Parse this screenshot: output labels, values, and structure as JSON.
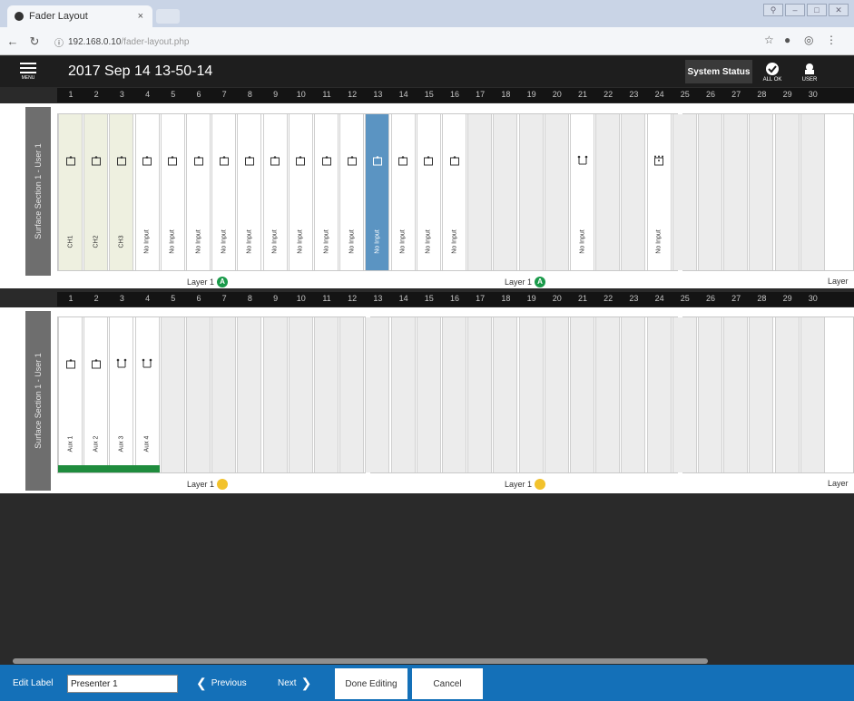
{
  "browser": {
    "tab_title": "Fader Layout",
    "tab_close": "×",
    "url_host": "192.168.0.10",
    "url_path": "/fader-layout.php"
  },
  "header": {
    "menu_label": "MENU",
    "title": "2017 Sep 14 13-50-14",
    "system_status": "System Status",
    "all_ok": "ALL OK",
    "user": "USER"
  },
  "fader_numbers": [
    "1",
    "2",
    "3",
    "4",
    "5",
    "6",
    "7",
    "8",
    "9",
    "10",
    "11",
    "12",
    "13",
    "14",
    "15",
    "16",
    "17",
    "18",
    "19",
    "20",
    "21",
    "22",
    "23",
    "24",
    "25",
    "26",
    "27",
    "28",
    "29",
    "30"
  ],
  "sections": [
    {
      "side_label": "Surface Section 1 - User 1",
      "layer_labels": [
        "Layer 1",
        "Layer 1",
        "Layer"
      ],
      "layer_badge": "A",
      "strips": [
        {
          "n": 1,
          "label": "CH1",
          "icon": "mono",
          "kind": "ch"
        },
        {
          "n": 2,
          "label": "CH2",
          "icon": "mono",
          "kind": "ch"
        },
        {
          "n": 3,
          "label": "CH3",
          "icon": "mono",
          "kind": "ch"
        },
        {
          "n": 4,
          "label": "No Input",
          "icon": "mono",
          "kind": "filled"
        },
        {
          "n": 5,
          "label": "No Input",
          "icon": "mono",
          "kind": "filled"
        },
        {
          "n": 6,
          "label": "No Input",
          "icon": "mono",
          "kind": "filled"
        },
        {
          "n": 7,
          "label": "No Input",
          "icon": "mono",
          "kind": "filled"
        },
        {
          "n": 8,
          "label": "No Input",
          "icon": "mono",
          "kind": "filled"
        },
        {
          "n": 9,
          "label": "No Input",
          "icon": "mono",
          "kind": "filled"
        },
        {
          "n": 10,
          "label": "No Input",
          "icon": "mono",
          "kind": "filled"
        },
        {
          "n": 11,
          "label": "No Input",
          "icon": "mono",
          "kind": "filled"
        },
        {
          "n": 12,
          "label": "No Input",
          "icon": "mono",
          "kind": "filled"
        },
        {
          "n": 13,
          "label": "No Input",
          "icon": "mono",
          "kind": "selected"
        },
        {
          "n": 14,
          "label": "No Input",
          "icon": "mono",
          "kind": "filled"
        },
        {
          "n": 15,
          "label": "No Input",
          "icon": "mono",
          "kind": "filled"
        },
        {
          "n": 16,
          "label": "No Input",
          "icon": "mono",
          "kind": "filled"
        },
        {
          "n": 21,
          "label": "No Input",
          "icon": "stereo",
          "kind": "filled"
        },
        {
          "n": 24,
          "label": "No Input",
          "icon": "multi",
          "kind": "filled"
        }
      ]
    },
    {
      "side_label": "Surface Section 1 - User 1",
      "layer_labels": [
        "Layer 1",
        "Layer 1",
        "Layer"
      ],
      "layer_badge": "",
      "strips": [
        {
          "n": 1,
          "label": "Aux 1",
          "icon": "mono",
          "kind": "filled"
        },
        {
          "n": 2,
          "label": "Aux 2",
          "icon": "mono",
          "kind": "filled"
        },
        {
          "n": 3,
          "label": "Aux 3",
          "icon": "stereo",
          "kind": "filled"
        },
        {
          "n": 4,
          "label": "Aux 4",
          "icon": "stereo",
          "kind": "filled"
        }
      ]
    }
  ],
  "editbar": {
    "label": "Edit Label",
    "value": "Presenter 1",
    "previous": "Previous",
    "next": "Next",
    "done": "Done Editing",
    "cancel": "Cancel"
  },
  "colors": {
    "selected_strip": "#5b94c2",
    "edit_bar": "#1470b8",
    "layer_badge_a": "#1a9a4a",
    "layer_badge_b": "#f2c22c",
    "assigned_bar": "#1f8c3d"
  }
}
